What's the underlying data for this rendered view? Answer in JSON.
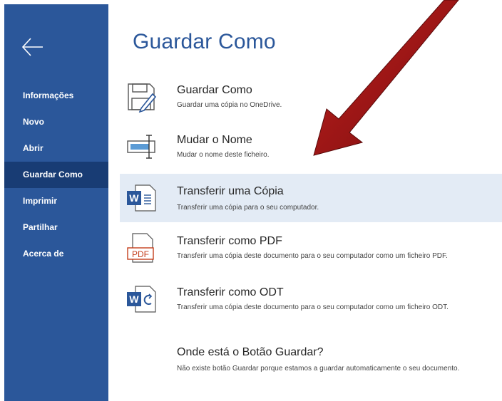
{
  "sidebar": {
    "items": [
      {
        "label": "Informações"
      },
      {
        "label": "Novo"
      },
      {
        "label": "Abrir"
      },
      {
        "label": "Guardar Como",
        "active": true
      },
      {
        "label": "Imprimir"
      },
      {
        "label": "Partilhar"
      },
      {
        "label": "Acerca de"
      }
    ]
  },
  "main": {
    "title": "Guardar Como",
    "options": [
      {
        "icon": "save-as-icon",
        "title": "Guardar Como",
        "description": "Guardar uma cópia no OneDrive."
      },
      {
        "icon": "rename-icon",
        "title": "Mudar o Nome",
        "description": "Mudar o nome deste ficheiro."
      },
      {
        "icon": "word-document-icon",
        "title": "Transferir uma Cópia",
        "description": "Transferir uma cópia para o seu computador."
      },
      {
        "icon": "pdf-document-icon",
        "title": "Transferir como PDF",
        "description": "Transferir uma cópia deste documento para o seu computador como um ficheiro PDF."
      },
      {
        "icon": "odt-document-icon",
        "title": "Transferir como ODT",
        "description": "Transferir uma cópia deste documento para o seu computador como um ficheiro ODT."
      },
      {
        "icon": "",
        "title": "Onde está o Botão Guardar?",
        "description": "Não existe botão Guardar porque estamos a guardar automaticamente o seu documento."
      }
    ],
    "icon_labels": {
      "pdf": "PDF",
      "word": "W"
    }
  },
  "colors": {
    "sidebar": "#2b579a",
    "sidebar_active": "#183c74",
    "title": "#2b579a",
    "selected_row": "#e3ebf5",
    "arrow": "#a01818"
  }
}
